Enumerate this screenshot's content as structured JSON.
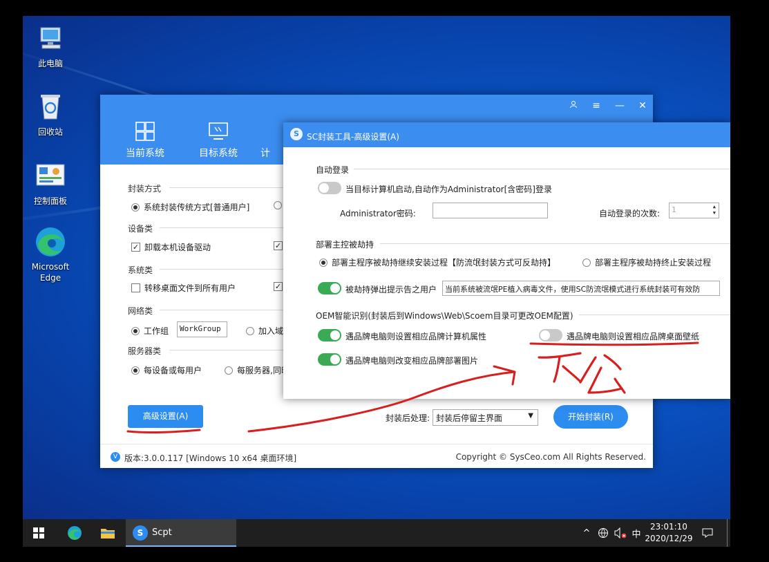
{
  "desktop": {
    "icons": [
      {
        "label": "此电脑",
        "icon": "computer-icon"
      },
      {
        "label": "回收站",
        "icon": "recycle-bin-icon"
      },
      {
        "label": "控制面板",
        "icon": "control-panel-icon"
      },
      {
        "label": "Microsoft Edge",
        "icon": "edge-icon"
      }
    ]
  },
  "main_window": {
    "nav": [
      {
        "label": "当前系统",
        "icon": "windows-logo-icon"
      },
      {
        "label": "目标系统",
        "icon": "monitor-icon"
      },
      {
        "label": "计",
        "icon": "tool-icon"
      }
    ],
    "sections": {
      "package_mode": {
        "title": "封装方式",
        "option1": "系统封装传统方式[普通用户]"
      },
      "devices": {
        "title": "设备类",
        "option1": "卸载本机设备驱动"
      },
      "system": {
        "title": "系统类",
        "option1": "转移桌面文件到所有用户"
      },
      "network": {
        "title": "网络类",
        "option1": "工作组",
        "workgroup_value": "WorkGroup",
        "option2": "加入域"
      },
      "server": {
        "title": "服务器类",
        "option1": "每设备或每用户",
        "option2": "每服务器,同时"
      }
    },
    "advanced_button": "高级设置(A)",
    "after_label": "封装后处理:",
    "after_value": "封装后停留主界面",
    "start_button": "开始封装(R)",
    "version": "版本:3.0.0.117 [Windows 10 x64 桌面环境]",
    "copyright": "Copyright © SysCeo.com All Rights Reserved."
  },
  "advanced_dialog": {
    "title": "SC封装工具-高级设置(A)",
    "autologin": {
      "title": "自动登录",
      "toggle_label": "当目标计算机启动,自动作为Administrator[含密码]登录",
      "toggle_on": false,
      "password_label": "Administrator密码:",
      "password_value": "",
      "count_label": "自动登录的次数:",
      "count_value": "1"
    },
    "hijack": {
      "title": "部署主控被劫持",
      "radio1": "部署主程序被劫持继续安装过程【防流氓封装方式可反劫持】",
      "radio2": "部署主程序被劫持终止安装过程",
      "toggle_label": "被劫持弹出提示告之用户",
      "toggle_on": true,
      "message": "当前系统被流氓PE植入病毒文件，使用SC防流氓模式进行系统封装可有效防"
    },
    "oem": {
      "title": "OEM智能识别(封装后到Windows\\Web\\Scoem目录可更改OEM配置)",
      "opt1": "遇品牌电脑则设置相应品牌计算机属性",
      "opt1_on": true,
      "opt2": "遇品牌电脑则设置相应品牌桌面壁纸",
      "opt2_on": false,
      "opt3": "遇品牌电脑则改变相应品牌部署图片",
      "opt3_on": true
    }
  },
  "annotation": {
    "handwriting": "不勾",
    "ink_color": "#d81e1e"
  },
  "taskbar": {
    "app_label": "Scpt",
    "ime": "中",
    "time": "23:01:10",
    "date": "2020/12/29"
  }
}
